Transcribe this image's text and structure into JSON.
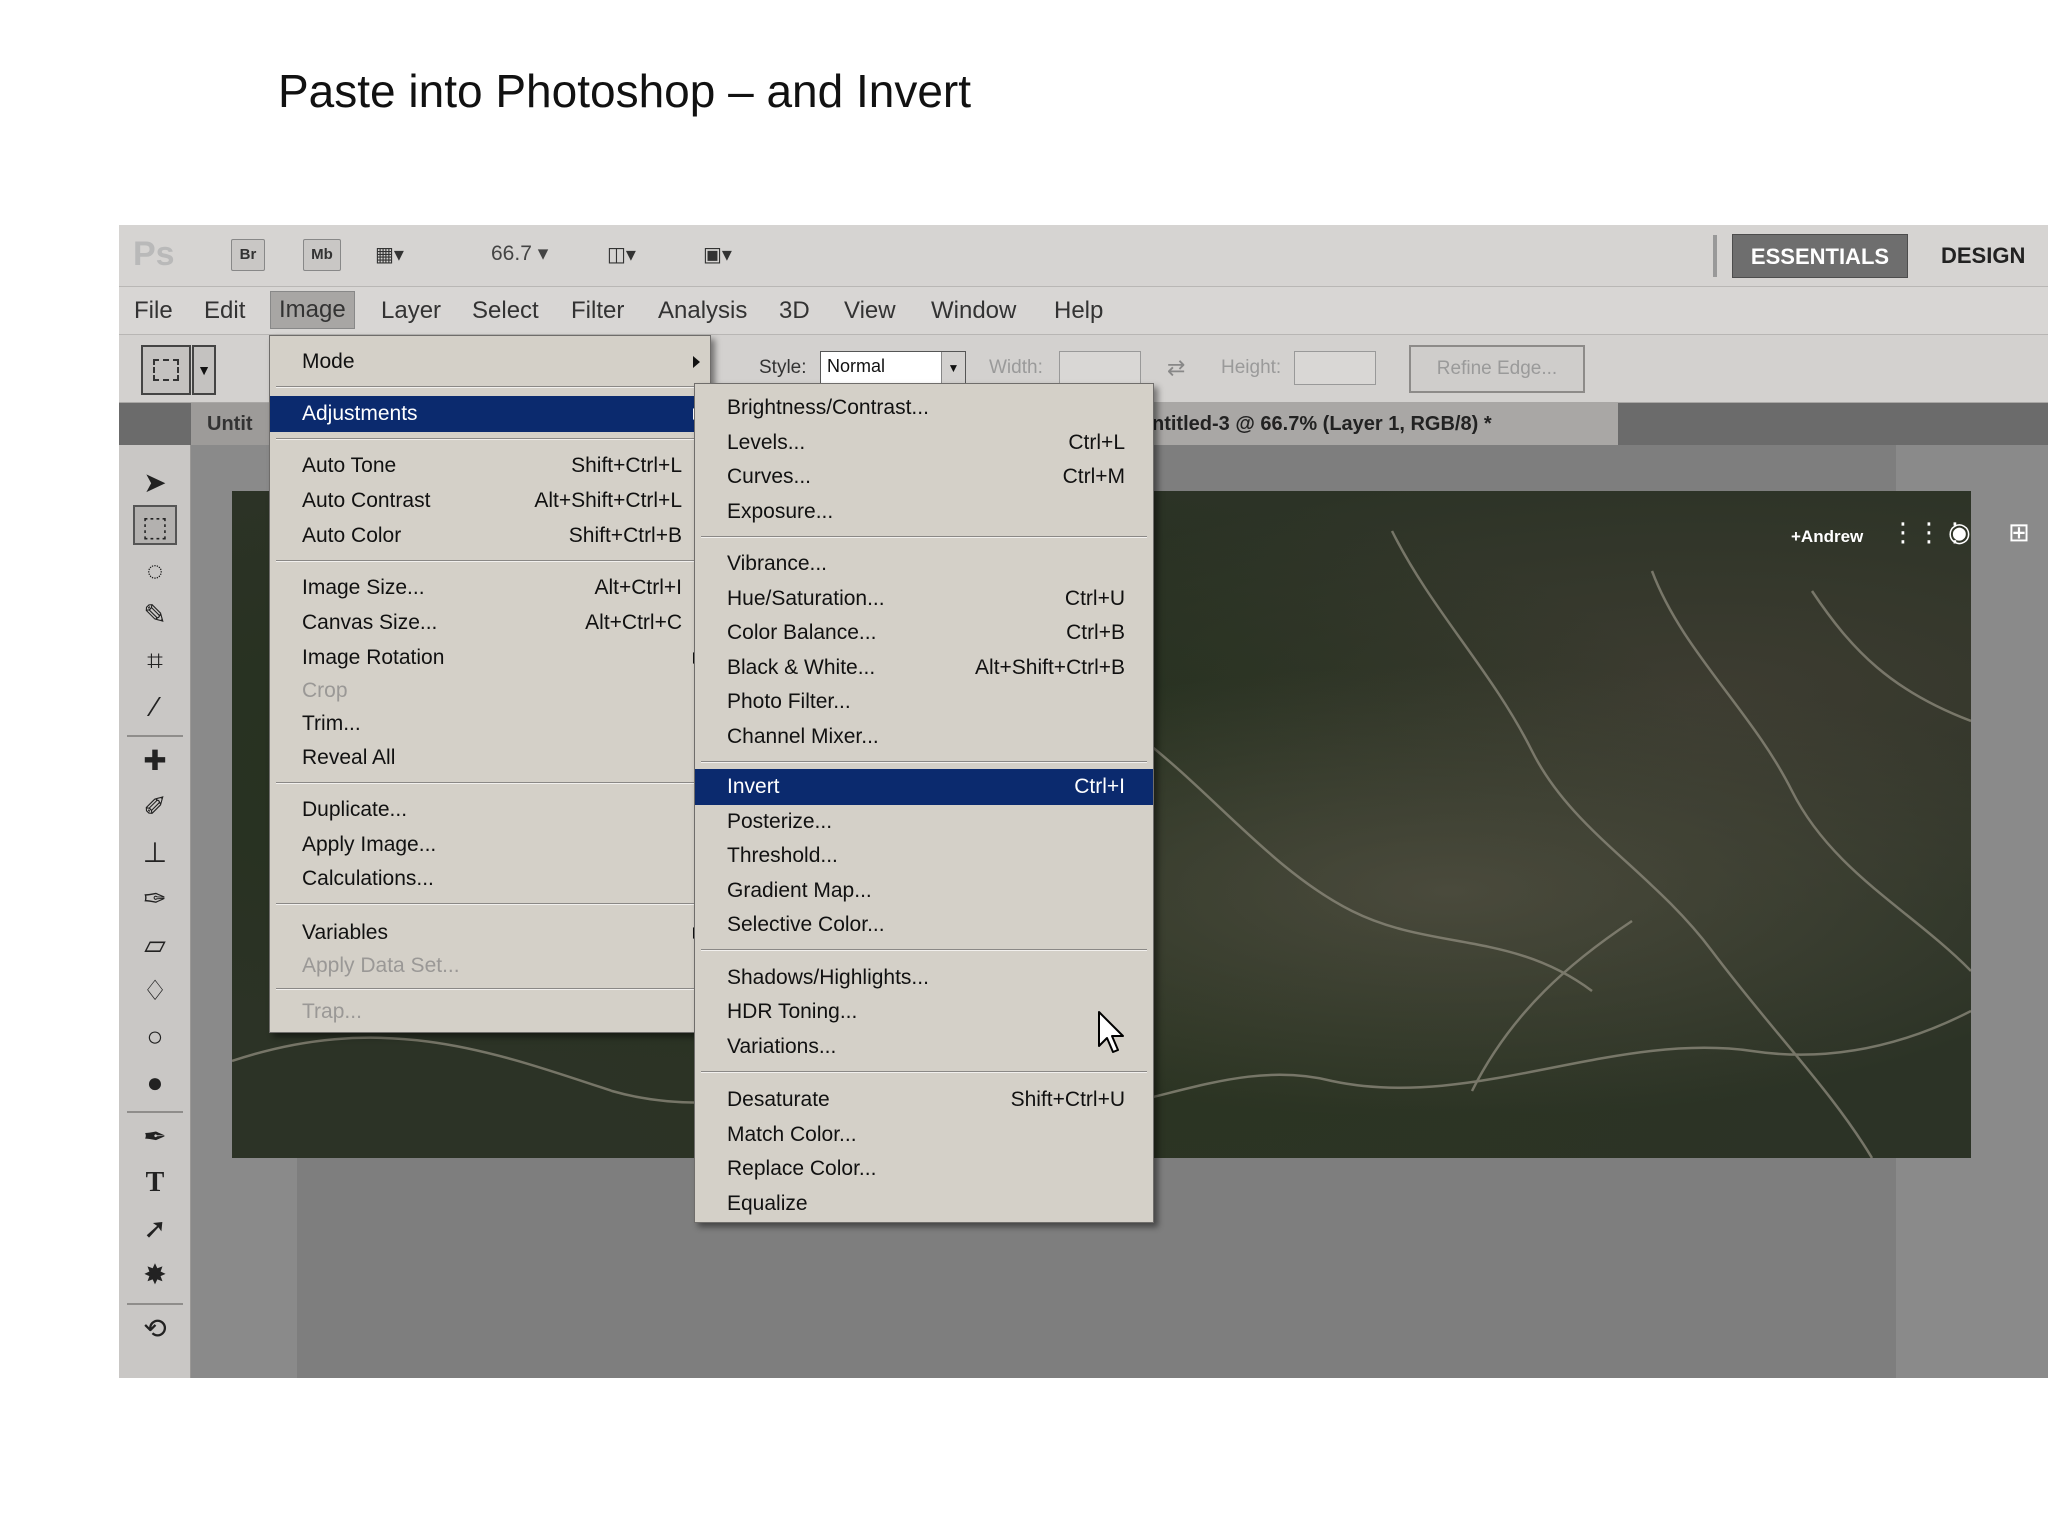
{
  "slide": {
    "title": "Paste into Photoshop – and Invert"
  },
  "appbar": {
    "logo": "Ps",
    "br_label": "Br",
    "mb_label": "Mb",
    "zoom": "66.7",
    "workspace_active": "ESSENTIALS",
    "workspace_other": "DESIGN"
  },
  "menubar": {
    "items": [
      "File",
      "Edit",
      "Image",
      "Layer",
      "Select",
      "Filter",
      "Analysis",
      "3D",
      "View",
      "Window",
      "Help"
    ],
    "active": "Image"
  },
  "options": {
    "style_label": "Style:",
    "style_value": "Normal",
    "width_label": "Width:",
    "height_label": "Height:",
    "refine_label": "Refine Edge..."
  },
  "tabs": {
    "left": "Untit",
    "doc": "ntitled-3 @ 66.7% (Layer 1, RGB/8) *",
    "close": "×"
  },
  "canvas_overlay": {
    "account_name": "+Andrew"
  },
  "image_menu": {
    "items": [
      {
        "label": "Mode",
        "shortcut": "",
        "submenu": true
      },
      {
        "label": "Adjustments",
        "shortcut": "",
        "submenu": true,
        "highlighted": true
      },
      {
        "label": "Auto Tone",
        "shortcut": "Shift+Ctrl+L"
      },
      {
        "label": "Auto Contrast",
        "shortcut": "Alt+Shift+Ctrl+L"
      },
      {
        "label": "Auto Color",
        "shortcut": "Shift+Ctrl+B"
      },
      {
        "label": "Image Size...",
        "shortcut": "Alt+Ctrl+I"
      },
      {
        "label": "Canvas Size...",
        "shortcut": "Alt+Ctrl+C"
      },
      {
        "label": "Image Rotation",
        "shortcut": "",
        "submenu": true
      },
      {
        "label": "Crop",
        "shortcut": "",
        "disabled": true
      },
      {
        "label": "Trim...",
        "shortcut": ""
      },
      {
        "label": "Reveal All",
        "shortcut": ""
      },
      {
        "label": "Duplicate...",
        "shortcut": ""
      },
      {
        "label": "Apply Image...",
        "shortcut": ""
      },
      {
        "label": "Calculations...",
        "shortcut": ""
      },
      {
        "label": "Variables",
        "shortcut": "",
        "submenu": true
      },
      {
        "label": "Apply Data Set...",
        "shortcut": "",
        "disabled": true
      },
      {
        "label": "Trap...",
        "shortcut": "",
        "disabled": true
      }
    ]
  },
  "adjustments_menu": {
    "items": [
      {
        "label": "Brightness/Contrast...",
        "shortcut": ""
      },
      {
        "label": "Levels...",
        "shortcut": "Ctrl+L"
      },
      {
        "label": "Curves...",
        "shortcut": "Ctrl+M"
      },
      {
        "label": "Exposure...",
        "shortcut": ""
      },
      {
        "label": "Vibrance...",
        "shortcut": ""
      },
      {
        "label": "Hue/Saturation...",
        "shortcut": "Ctrl+U"
      },
      {
        "label": "Color Balance...",
        "shortcut": "Ctrl+B"
      },
      {
        "label": "Black & White...",
        "shortcut": "Alt+Shift+Ctrl+B"
      },
      {
        "label": "Photo Filter...",
        "shortcut": ""
      },
      {
        "label": "Channel Mixer...",
        "shortcut": ""
      },
      {
        "label": "Invert",
        "shortcut": "Ctrl+I",
        "highlighted": true
      },
      {
        "label": "Posterize...",
        "shortcut": ""
      },
      {
        "label": "Threshold...",
        "shortcut": ""
      },
      {
        "label": "Gradient Map...",
        "shortcut": ""
      },
      {
        "label": "Selective Color...",
        "shortcut": ""
      },
      {
        "label": "Shadows/Highlights...",
        "shortcut": ""
      },
      {
        "label": "HDR Toning...",
        "shortcut": ""
      },
      {
        "label": "Variations...",
        "shortcut": ""
      },
      {
        "label": "Desaturate",
        "shortcut": "Shift+Ctrl+U"
      },
      {
        "label": "Match Color...",
        "shortcut": ""
      },
      {
        "label": "Replace Color...",
        "shortcut": ""
      },
      {
        "label": "Equalize",
        "shortcut": ""
      }
    ]
  },
  "colors": {
    "menu_highlight": "#0b2a6e",
    "menu_bg": "#d4d0c8",
    "workspace_button": "#6e6e6e",
    "avatar": "#4a8fe6"
  }
}
